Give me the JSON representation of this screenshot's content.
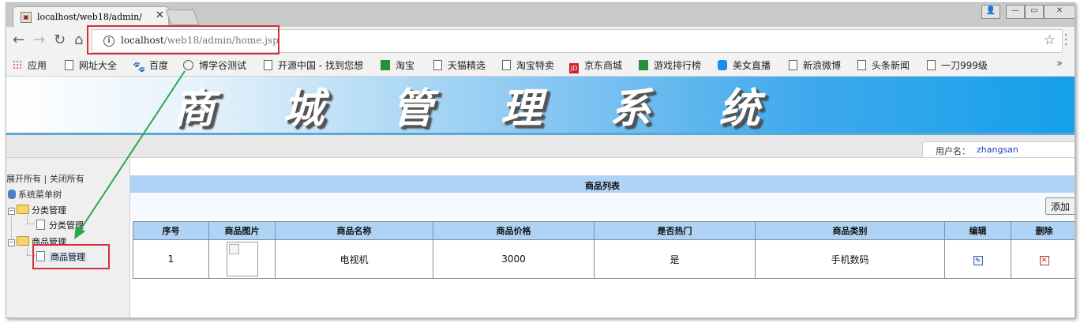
{
  "browser": {
    "tab_title": "localhost/web18/admin/",
    "url_host": "localhost",
    "url_path": "/web18/admin/home.jsp",
    "bookmarks": [
      {
        "label": "应用",
        "icon": "apps-icon"
      },
      {
        "label": "网址大全",
        "icon": "page-icon"
      },
      {
        "label": "百度",
        "icon": "baidu-icon"
      },
      {
        "label": "博学谷测试",
        "icon": "circle-icon"
      },
      {
        "label": "开源中国 - 找到您想",
        "icon": "page-icon"
      },
      {
        "label": "淘宝",
        "icon": "green-icon"
      },
      {
        "label": "天猫精选",
        "icon": "page-icon"
      },
      {
        "label": "淘宝特卖",
        "icon": "page-icon"
      },
      {
        "label": "京东商城",
        "icon": "jd-icon"
      },
      {
        "label": "游戏排行榜",
        "icon": "green-icon"
      },
      {
        "label": "美女直播",
        "icon": "wifi-icon"
      },
      {
        "label": "新浪微博",
        "icon": "page-icon"
      },
      {
        "label": "头条新闻",
        "icon": "page-icon"
      },
      {
        "label": "一刀999级",
        "icon": "page-icon"
      }
    ],
    "more": "»"
  },
  "header": {
    "title": "商 城 管 理 系 统",
    "user_label": "用户名：",
    "username": "zhangsan"
  },
  "sidebar": {
    "expand_all": "展开所有",
    "separator": "|",
    "collapse_all": "关闭所有",
    "root": "系统菜单树",
    "groups": [
      {
        "label": "分类管理",
        "child": "分类管理"
      },
      {
        "label": "商品管理",
        "child": "商品管理"
      }
    ]
  },
  "main": {
    "list_title": "商品列表",
    "add_button": "添加",
    "columns": [
      "序号",
      "商品图片",
      "商品名称",
      "商品价格",
      "是否热门",
      "商品类别",
      "编辑",
      "删除"
    ],
    "rows": [
      {
        "index": "1",
        "name": "电视机",
        "price": "3000",
        "hot": "是",
        "category": "手机数码"
      }
    ]
  },
  "colors": {
    "header_blue": "#afd3f5",
    "annotation_red": "#d0313a",
    "annotation_arrow": "#2aa84a",
    "username_blue": "#1c3fb0"
  }
}
